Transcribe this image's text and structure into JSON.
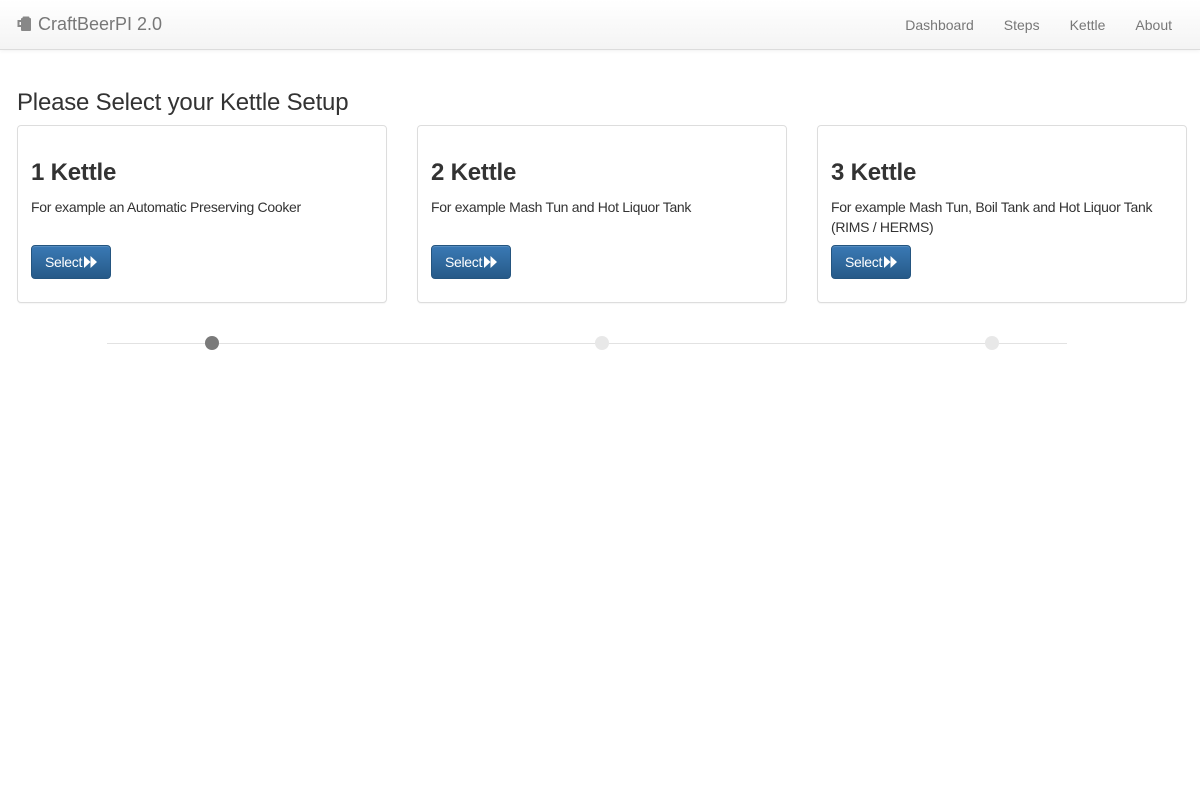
{
  "app": {
    "brand": "CraftBeerPI 2.0",
    "brand_icon": "beer-mug-icon"
  },
  "nav": {
    "items": [
      {
        "label": "Dashboard"
      },
      {
        "label": "Steps"
      },
      {
        "label": "Kettle"
      },
      {
        "label": "About"
      }
    ]
  },
  "main": {
    "title": "Please Select your Kettle Setup",
    "cards": [
      {
        "title": "1 Kettle",
        "description": "For example an Automatic Preserving Cooker",
        "button_label": "Select"
      },
      {
        "title": "2 Kettle",
        "description": "For example Mash Tun and Hot Liquor Tank",
        "button_label": "Select"
      },
      {
        "title": "3 Kettle",
        "description": "For example Mash Tun, Boil Tank and Hot Liquor Tank (RIMS / HERMS)",
        "button_label": "Select"
      }
    ],
    "button_icon": "fast-forward-icon"
  },
  "stepper": {
    "total_steps": 3,
    "current_step": 1
  },
  "colors": {
    "primary": "#2e6da4",
    "nav_text": "#777777",
    "active_step": "#7a7a7a",
    "inactive_step": "#e8e8e8"
  }
}
